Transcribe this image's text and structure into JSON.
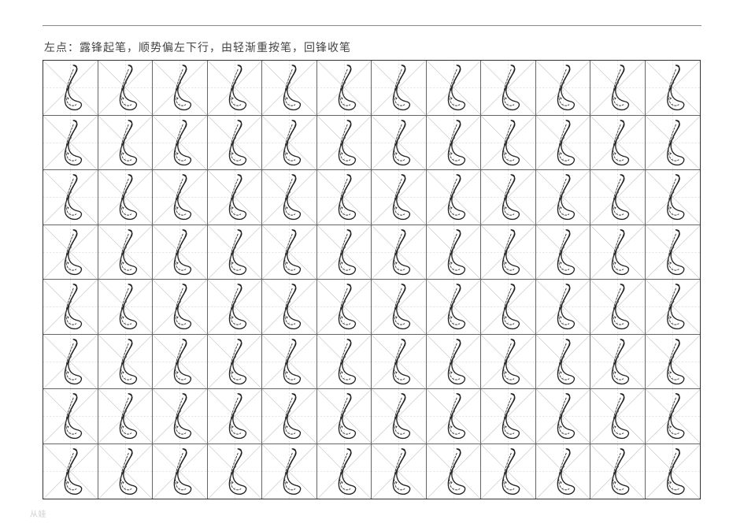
{
  "instruction": "左点：露锋起笔，顺势偏左下行，由轻渐重按笔，回锋收笔",
  "footer_note": "从娃",
  "grid": {
    "rows": 8,
    "cols": 12
  },
  "stroke": {
    "name": "left-dot",
    "color": "#222222",
    "dash_color": "#444444"
  },
  "guide": {
    "line_color": "#bdbdbd",
    "dash_color": "#c8c8c8"
  }
}
